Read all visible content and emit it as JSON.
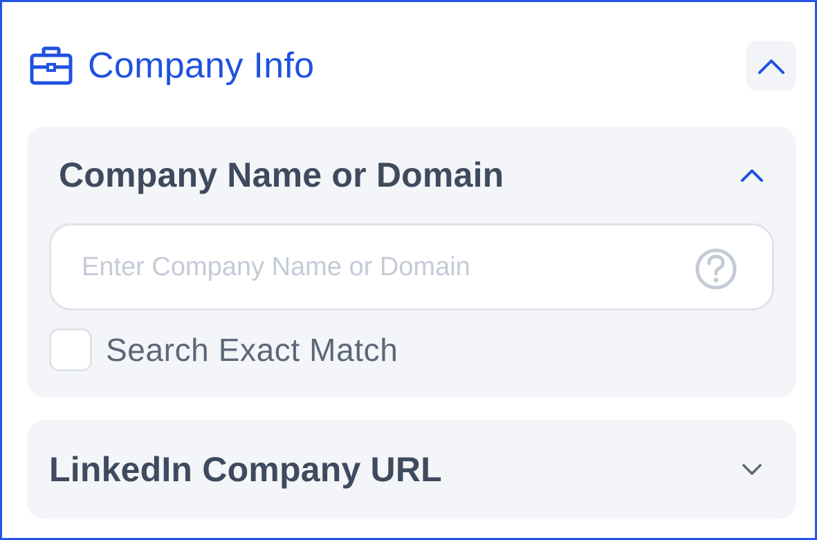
{
  "header": {
    "icon": "briefcase-icon",
    "title": "Company Info",
    "toggle_icon": "chevron-up-icon"
  },
  "sections": [
    {
      "title": "Company Name or Domain",
      "expanded": true,
      "toggle_icon": "chevron-up-icon",
      "input": {
        "value": "",
        "placeholder": "Enter Company Name or Domain",
        "help_icon": "question-circle-icon"
      },
      "checkbox": {
        "label": "Search Exact Match",
        "checked": false
      }
    },
    {
      "title": "LinkedIn Company URL",
      "expanded": false,
      "toggle_icon": "chevron-down-icon"
    }
  ],
  "colors": {
    "accent": "#1f51e0",
    "border": "#2455e6",
    "section_bg": "#f3f5f8",
    "heading": "#3f4a5e",
    "muted": "#c4cbd6"
  }
}
